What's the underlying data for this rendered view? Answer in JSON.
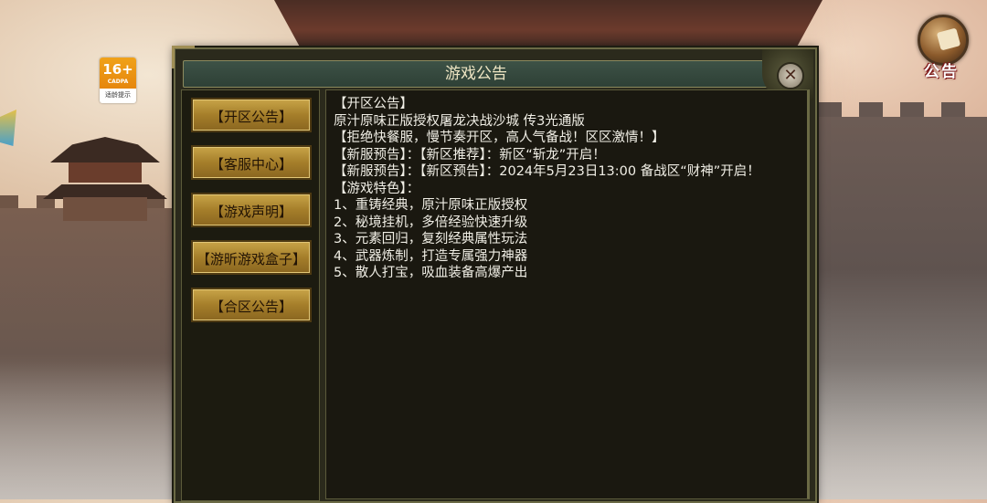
{
  "age_rating": {
    "number": "16+",
    "org": "CADPA",
    "tip": "适龄提示"
  },
  "notice_icon": {
    "label": "公告",
    "icon": "scroll-icon"
  },
  "dialog": {
    "title": "游戏公告",
    "close_icon": "close-icon",
    "tabs": [
      {
        "label": "【开区公告】"
      },
      {
        "label": "【客服中心】"
      },
      {
        "label": "【游戏声明】"
      },
      {
        "label": "【游昕游戏盒子】"
      },
      {
        "label": "【合区公告】"
      }
    ],
    "content_lines": [
      "【开区公告】",
      "原汁原味正版授权屠龙决战沙城 传3光通版",
      "【拒绝快餐服，慢节奏开区，高人气备战！区区激情！】",
      "【新服预告】：【新区推荐】：新区“斩龙”开启！",
      "【新服预告】：【新区预告】：2024年5月23日13:00 备战区“财神”开启！",
      "【游戏特色】：",
      "1、重铸经典，原汁原味正版授权",
      "2、秘境挂机，多倍经验快速升级",
      "3、元素回归，复刻经典属性玩法",
      "4、武器炼制，打造专属强力神器",
      "5、散人打宝，吸血装备高爆产出"
    ]
  },
  "colors": {
    "tab_gold": "#c8a448",
    "title_bar": "#3d5246",
    "panel_bg": "#1a1810",
    "text": "#f1efe6"
  }
}
